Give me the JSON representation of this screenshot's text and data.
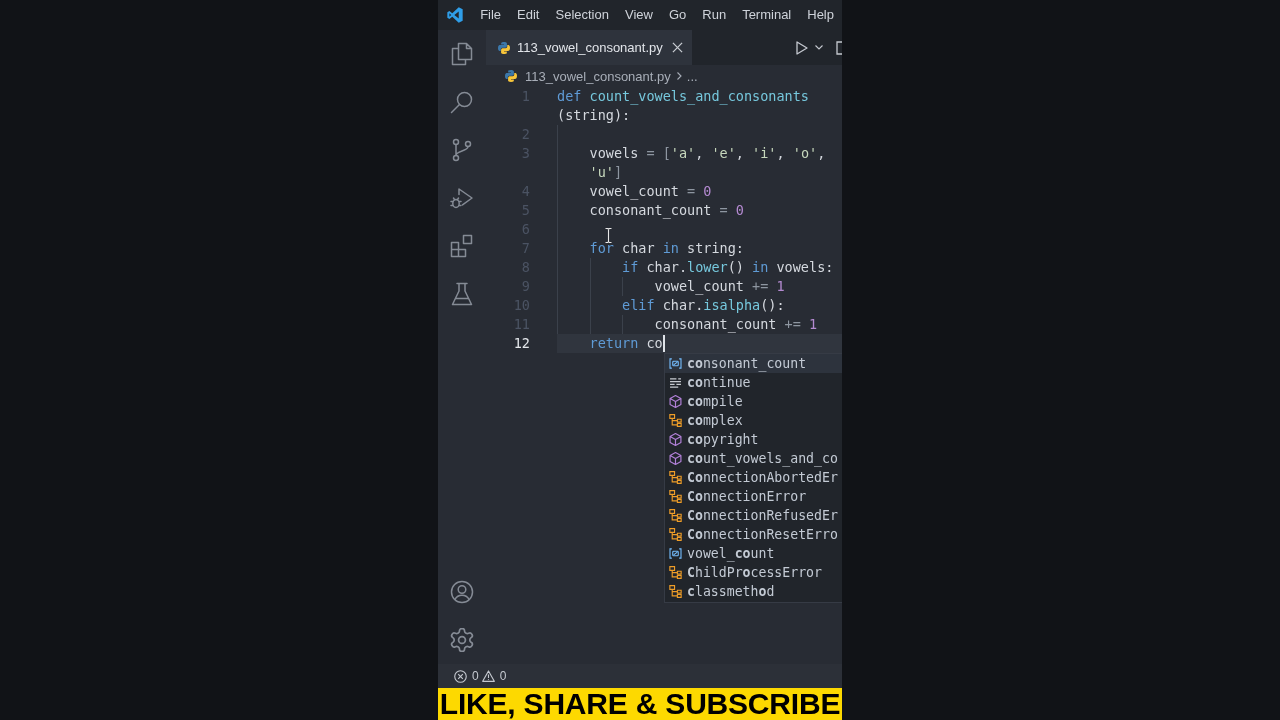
{
  "menu": [
    "File",
    "Edit",
    "Selection",
    "View",
    "Go",
    "Run",
    "Terminal",
    "Help"
  ],
  "tabs": [
    {
      "label": "113_vowel_consonant.py",
      "selected": true
    }
  ],
  "breadcrumb": [
    "113_vowel_consonant.py",
    "..."
  ],
  "editor": {
    "lines": [
      {
        "number": "1",
        "current": false,
        "wraps": [
          {
            "tokens": [
              {
                "text": "def",
                "kind": "keyword"
              },
              {
                "text": " count_vowels_and_consonants",
                "kind": "function"
              }
            ]
          },
          {
            "tokens": [
              {
                "text": "(string):",
                "kind": "plain"
              }
            ]
          }
        ]
      },
      {
        "number": "2",
        "current": false
      },
      {
        "number": "3",
        "current": false,
        "wraps": [
          {
            "tokens": [
              {
                "text": "    vowels",
                "kind": "plain"
              },
              {
                "text": " = [",
                "kind": "operator"
              },
              {
                "text": "'a'",
                "kind": "string"
              },
              {
                "text": ", ",
                "kind": "plain"
              },
              {
                "text": "'e'",
                "kind": "string"
              },
              {
                "text": ", ",
                "kind": "plain"
              },
              {
                "text": "'i'",
                "kind": "string"
              },
              {
                "text": ", ",
                "kind": "plain"
              },
              {
                "text": "'o'",
                "kind": "string"
              },
              {
                "text": ",",
                "kind": "plain"
              }
            ]
          },
          {
            "tokens": [
              {
                "text": "    'u'",
                "kind": "string"
              },
              {
                "text": "]",
                "kind": "operator"
              }
            ]
          }
        ]
      },
      {
        "number": "4",
        "current": false,
        "wraps": [
          {
            "tokens": [
              {
                "text": "    vowel_count",
                "kind": "plain"
              },
              {
                "text": " = ",
                "kind": "operator"
              },
              {
                "text": "0",
                "kind": "number"
              }
            ]
          }
        ]
      },
      {
        "number": "5",
        "current": false,
        "wraps": [
          {
            "tokens": [
              {
                "text": "    consonant_count",
                "kind": "plain"
              },
              {
                "text": " = ",
                "kind": "operator"
              },
              {
                "text": "0",
                "kind": "number"
              }
            ]
          }
        ]
      },
      {
        "number": "6",
        "current": false
      },
      {
        "number": "7",
        "current": false,
        "wraps": [
          {
            "tokens": [
              {
                "text": "    for",
                "kind": "keyword"
              },
              {
                "text": " char ",
                "kind": "plain"
              },
              {
                "text": "in",
                "kind": "keyword"
              },
              {
                "text": " string:",
                "kind": "plain"
              }
            ]
          }
        ]
      },
      {
        "number": "8",
        "current": false,
        "wraps": [
          {
            "tokens": [
              {
                "text": "        if",
                "kind": "keyword"
              },
              {
                "text": " char.",
                "kind": "plain"
              },
              {
                "text": "lower",
                "kind": "function"
              },
              {
                "text": "() ",
                "kind": "plain"
              },
              {
                "text": "in",
                "kind": "keyword"
              },
              {
                "text": " vowels:",
                "kind": "plain"
              }
            ]
          }
        ]
      },
      {
        "number": "9",
        "current": false,
        "wraps": [
          {
            "tokens": [
              {
                "text": "            vowel_count",
                "kind": "plain"
              },
              {
                "text": " += ",
                "kind": "operator"
              },
              {
                "text": "1",
                "kind": "number"
              }
            ]
          }
        ]
      },
      {
        "number": "10",
        "current": false,
        "wraps": [
          {
            "tokens": [
              {
                "text": "        elif",
                "kind": "keyword"
              },
              {
                "text": " char.",
                "kind": "plain"
              },
              {
                "text": "isalpha",
                "kind": "function"
              },
              {
                "text": "():",
                "kind": "plain"
              }
            ]
          }
        ]
      },
      {
        "number": "11",
        "current": false,
        "wraps": [
          {
            "tokens": [
              {
                "text": "            consonant_count",
                "kind": "plain"
              },
              {
                "text": " += ",
                "kind": "operator"
              },
              {
                "text": "1",
                "kind": "number"
              }
            ]
          }
        ]
      },
      {
        "number": "12",
        "current": true,
        "wraps": [
          {
            "tokens": [
              {
                "text": "    return",
                "kind": "keyword"
              },
              {
                "text": " co",
                "kind": "plain"
              }
            ]
          }
        ]
      }
    ]
  },
  "autocomplete": {
    "suggestions": [
      {
        "label": "**co**nsonant_count",
        "kind": "variable",
        "selected": true
      },
      {
        "label": "**co**ntinue",
        "kind": "keyword",
        "selected": false
      },
      {
        "label": "**co**mpile",
        "kind": "function",
        "selected": false
      },
      {
        "label": "**co**mplex",
        "kind": "class",
        "selected": false
      },
      {
        "label": "**co**pyright",
        "kind": "function",
        "selected": false
      },
      {
        "label": "**co**unt_vowels_and_co",
        "kind": "function",
        "selected": false
      },
      {
        "label": "**Co**nnectionAbortedEr",
        "kind": "class",
        "selected": false
      },
      {
        "label": "**Co**nnectionError",
        "kind": "class",
        "selected": false
      },
      {
        "label": "**Co**nnectionRefusedEr",
        "kind": "class",
        "selected": false
      },
      {
        "label": "**Co**nnectionResetErro",
        "kind": "class",
        "selected": false
      },
      {
        "label": "vowel_**co**unt",
        "kind": "variable",
        "selected": false
      },
      {
        "label": "**C**hildPr**o**cessError",
        "kind": "class",
        "selected": false
      },
      {
        "label": "**c**lassmeth**o**d",
        "kind": "class",
        "selected": false
      }
    ]
  },
  "status_bar": {
    "errors": "0",
    "warnings": "0"
  },
  "banner": {
    "text": "LIKE, SHARE & SUBSCRIBE"
  }
}
